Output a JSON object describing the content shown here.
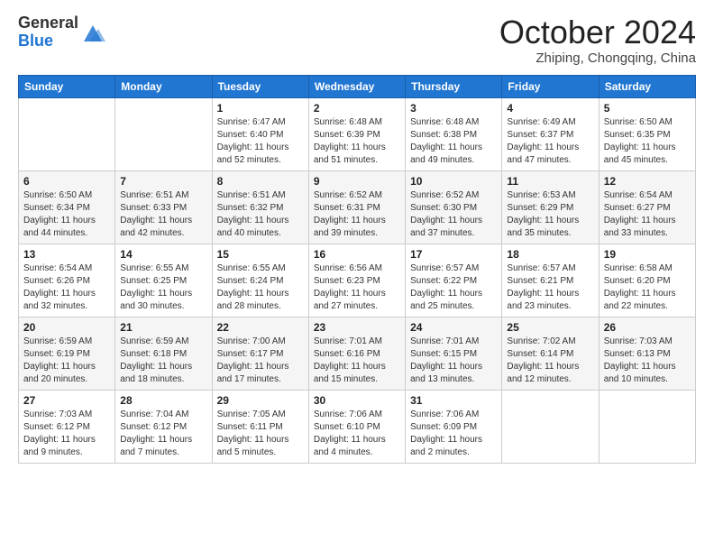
{
  "header": {
    "logo_general": "General",
    "logo_blue": "Blue",
    "month_title": "October 2024",
    "location": "Zhiping, Chongqing, China"
  },
  "weekdays": [
    "Sunday",
    "Monday",
    "Tuesday",
    "Wednesday",
    "Thursday",
    "Friday",
    "Saturday"
  ],
  "weeks": [
    {
      "row_class": "row-white",
      "days": [
        {
          "num": "",
          "detail": ""
        },
        {
          "num": "",
          "detail": ""
        },
        {
          "num": "1",
          "detail": "Sunrise: 6:47 AM\nSunset: 6:40 PM\nDaylight: 11 hours\nand 52 minutes."
        },
        {
          "num": "2",
          "detail": "Sunrise: 6:48 AM\nSunset: 6:39 PM\nDaylight: 11 hours\nand 51 minutes."
        },
        {
          "num": "3",
          "detail": "Sunrise: 6:48 AM\nSunset: 6:38 PM\nDaylight: 11 hours\nand 49 minutes."
        },
        {
          "num": "4",
          "detail": "Sunrise: 6:49 AM\nSunset: 6:37 PM\nDaylight: 11 hours\nand 47 minutes."
        },
        {
          "num": "5",
          "detail": "Sunrise: 6:50 AM\nSunset: 6:35 PM\nDaylight: 11 hours\nand 45 minutes."
        }
      ]
    },
    {
      "row_class": "row-gray",
      "days": [
        {
          "num": "6",
          "detail": "Sunrise: 6:50 AM\nSunset: 6:34 PM\nDaylight: 11 hours\nand 44 minutes."
        },
        {
          "num": "7",
          "detail": "Sunrise: 6:51 AM\nSunset: 6:33 PM\nDaylight: 11 hours\nand 42 minutes."
        },
        {
          "num": "8",
          "detail": "Sunrise: 6:51 AM\nSunset: 6:32 PM\nDaylight: 11 hours\nand 40 minutes."
        },
        {
          "num": "9",
          "detail": "Sunrise: 6:52 AM\nSunset: 6:31 PM\nDaylight: 11 hours\nand 39 minutes."
        },
        {
          "num": "10",
          "detail": "Sunrise: 6:52 AM\nSunset: 6:30 PM\nDaylight: 11 hours\nand 37 minutes."
        },
        {
          "num": "11",
          "detail": "Sunrise: 6:53 AM\nSunset: 6:29 PM\nDaylight: 11 hours\nand 35 minutes."
        },
        {
          "num": "12",
          "detail": "Sunrise: 6:54 AM\nSunset: 6:27 PM\nDaylight: 11 hours\nand 33 minutes."
        }
      ]
    },
    {
      "row_class": "row-white",
      "days": [
        {
          "num": "13",
          "detail": "Sunrise: 6:54 AM\nSunset: 6:26 PM\nDaylight: 11 hours\nand 32 minutes."
        },
        {
          "num": "14",
          "detail": "Sunrise: 6:55 AM\nSunset: 6:25 PM\nDaylight: 11 hours\nand 30 minutes."
        },
        {
          "num": "15",
          "detail": "Sunrise: 6:55 AM\nSunset: 6:24 PM\nDaylight: 11 hours\nand 28 minutes."
        },
        {
          "num": "16",
          "detail": "Sunrise: 6:56 AM\nSunset: 6:23 PM\nDaylight: 11 hours\nand 27 minutes."
        },
        {
          "num": "17",
          "detail": "Sunrise: 6:57 AM\nSunset: 6:22 PM\nDaylight: 11 hours\nand 25 minutes."
        },
        {
          "num": "18",
          "detail": "Sunrise: 6:57 AM\nSunset: 6:21 PM\nDaylight: 11 hours\nand 23 minutes."
        },
        {
          "num": "19",
          "detail": "Sunrise: 6:58 AM\nSunset: 6:20 PM\nDaylight: 11 hours\nand 22 minutes."
        }
      ]
    },
    {
      "row_class": "row-gray",
      "days": [
        {
          "num": "20",
          "detail": "Sunrise: 6:59 AM\nSunset: 6:19 PM\nDaylight: 11 hours\nand 20 minutes."
        },
        {
          "num": "21",
          "detail": "Sunrise: 6:59 AM\nSunset: 6:18 PM\nDaylight: 11 hours\nand 18 minutes."
        },
        {
          "num": "22",
          "detail": "Sunrise: 7:00 AM\nSunset: 6:17 PM\nDaylight: 11 hours\nand 17 minutes."
        },
        {
          "num": "23",
          "detail": "Sunrise: 7:01 AM\nSunset: 6:16 PM\nDaylight: 11 hours\nand 15 minutes."
        },
        {
          "num": "24",
          "detail": "Sunrise: 7:01 AM\nSunset: 6:15 PM\nDaylight: 11 hours\nand 13 minutes."
        },
        {
          "num": "25",
          "detail": "Sunrise: 7:02 AM\nSunset: 6:14 PM\nDaylight: 11 hours\nand 12 minutes."
        },
        {
          "num": "26",
          "detail": "Sunrise: 7:03 AM\nSunset: 6:13 PM\nDaylight: 11 hours\nand 10 minutes."
        }
      ]
    },
    {
      "row_class": "row-white",
      "days": [
        {
          "num": "27",
          "detail": "Sunrise: 7:03 AM\nSunset: 6:12 PM\nDaylight: 11 hours\nand 9 minutes."
        },
        {
          "num": "28",
          "detail": "Sunrise: 7:04 AM\nSunset: 6:12 PM\nDaylight: 11 hours\nand 7 minutes."
        },
        {
          "num": "29",
          "detail": "Sunrise: 7:05 AM\nSunset: 6:11 PM\nDaylight: 11 hours\nand 5 minutes."
        },
        {
          "num": "30",
          "detail": "Sunrise: 7:06 AM\nSunset: 6:10 PM\nDaylight: 11 hours\nand 4 minutes."
        },
        {
          "num": "31",
          "detail": "Sunrise: 7:06 AM\nSunset: 6:09 PM\nDaylight: 11 hours\nand 2 minutes."
        },
        {
          "num": "",
          "detail": ""
        },
        {
          "num": "",
          "detail": ""
        }
      ]
    }
  ]
}
